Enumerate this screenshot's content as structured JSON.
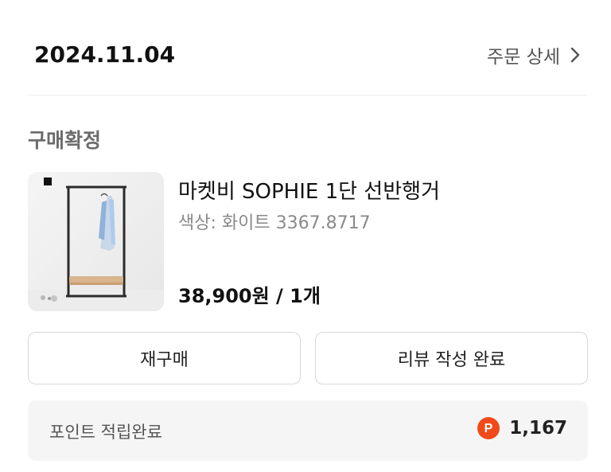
{
  "order": {
    "date": "2024.11.04",
    "detail_link_label": "주문 상세",
    "status": "구매확정"
  },
  "product": {
    "name": "마켓비 SOPHIE 1단 선반행거",
    "option": "색상: 화이트 3367.8717",
    "price_quantity": "38,900원 / 1개"
  },
  "actions": {
    "rebuy_label": "재구매",
    "review_label": "리뷰 작성 완료"
  },
  "points": {
    "label": "포인트 적립완료",
    "value": "1,167",
    "icon_letter": "P",
    "icon_color": "#F04A1A"
  },
  "colors": {
    "text_primary": "#111111",
    "text_secondary": "#555555",
    "text_muted": "#8A8A8A",
    "divider": "#EEEEEE",
    "button_border": "#D8D8D8",
    "points_background": "#F5F5F5"
  },
  "icons": {
    "detail_chevron": "chevron-right-icon",
    "points_badge": "point-icon"
  }
}
